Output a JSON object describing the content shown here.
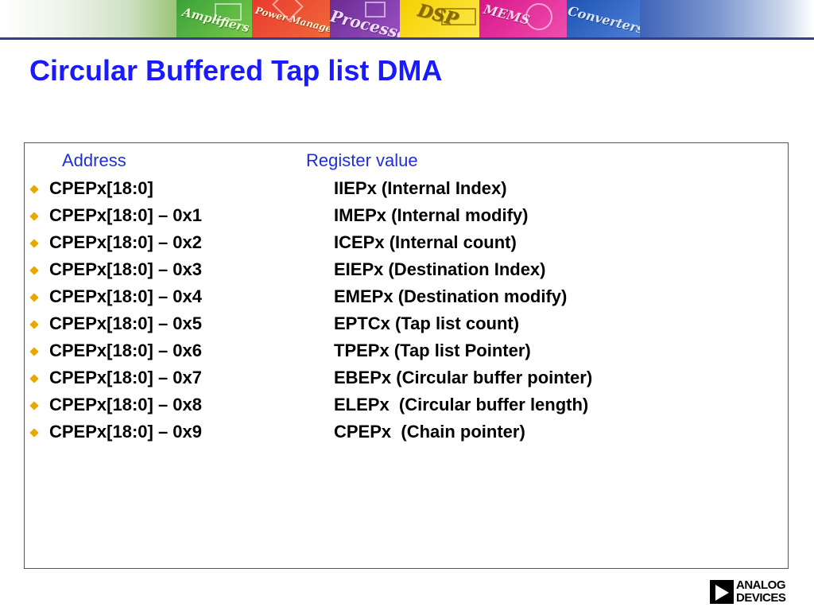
{
  "banner": {
    "tiles": [
      "Amplifiers",
      "Power Management",
      "Processors",
      "DSP",
      "MEMS",
      "Converters"
    ]
  },
  "slide": {
    "title": "Circular Buffered Tap list DMA",
    "headers": {
      "address": "Address",
      "register": "Register value"
    },
    "rows": [
      {
        "address": "CPEPx[18:0]",
        "register": "IIEPx (Internal Index)"
      },
      {
        "address": "CPEPx[18:0] – 0x1",
        "register": "IMEPx (Internal modify)"
      },
      {
        "address": "CPEPx[18:0] – 0x2",
        "register": "ICEPx (Internal count)"
      },
      {
        "address": "CPEPx[18:0] – 0x3",
        "register": "EIEPx (Destination Index)"
      },
      {
        "address": "CPEPx[18:0] – 0x4",
        "register": "EMEPx (Destination modify)"
      },
      {
        "address": "CPEPx[18:0] – 0x5",
        "register": "EPTCx (Tap list count)"
      },
      {
        "address": "CPEPx[18:0] – 0x6",
        "register": "TPEPx (Tap list Pointer)"
      },
      {
        "address": "CPEPx[18:0] – 0x7",
        "register": "EBEPx (Circular buffer pointer)"
      },
      {
        "address": "CPEPx[18:0] – 0x8",
        "register": "ELEPx  (Circular buffer length)"
      },
      {
        "address": "CPEPx[18:0] – 0x9",
        "register": "CPEPx  (Chain pointer)"
      }
    ]
  },
  "logo": {
    "line1": "ANALOG",
    "line2": "DEVICES"
  },
  "colors": {
    "title": "#1a1aff",
    "header": "#1f2fd6",
    "bullet": "#e8a800"
  }
}
